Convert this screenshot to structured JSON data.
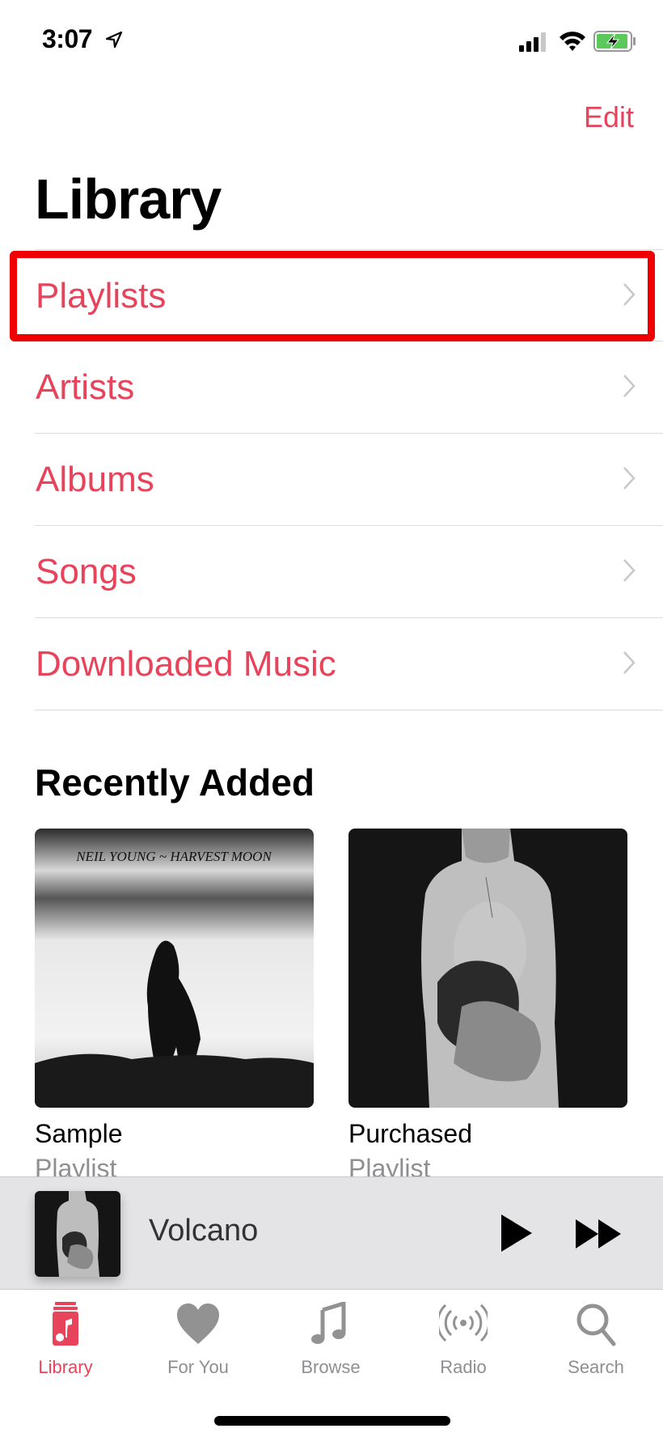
{
  "status_bar": {
    "time": "3:07",
    "location_icon": "location-arrow-icon",
    "signal_icon": "cellular-signal-icon",
    "wifi_icon": "wifi-icon",
    "battery_icon": "battery-charging-icon"
  },
  "header": {
    "edit_label": "Edit",
    "title": "Library"
  },
  "library_items": [
    {
      "label": "Playlists",
      "highlighted": true
    },
    {
      "label": "Artists"
    },
    {
      "label": "Albums"
    },
    {
      "label": "Songs"
    },
    {
      "label": "Downloaded Music"
    }
  ],
  "recently_added": {
    "title": "Recently Added",
    "items": [
      {
        "name": "Sample",
        "type": "Playlist",
        "art_text": "NEIL YOUNG ~ HARVEST MOON"
      },
      {
        "name": "Purchased",
        "type": "Playlist"
      }
    ]
  },
  "mini_player": {
    "track": "Volcano",
    "play_icon": "play-icon",
    "next_icon": "fast-forward-icon"
  },
  "tab_bar": {
    "tabs": [
      {
        "label": "Library",
        "icon": "library-icon",
        "active": true
      },
      {
        "label": "For You",
        "icon": "heart-icon"
      },
      {
        "label": "Browse",
        "icon": "music-note-icon"
      },
      {
        "label": "Radio",
        "icon": "radio-broadcast-icon"
      },
      {
        "label": "Search",
        "icon": "search-icon"
      }
    ]
  },
  "colors": {
    "accent": "#e7445c",
    "highlight_box": "#f00000",
    "inactive": "#8e8e93"
  }
}
